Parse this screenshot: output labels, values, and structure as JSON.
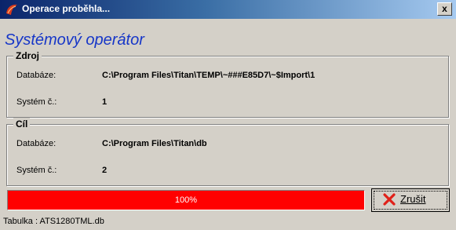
{
  "window": {
    "title": "Operace proběhla...",
    "close_label": "x"
  },
  "operator_title": "Systémový operátor",
  "source": {
    "legend": "Zdroj",
    "database_label": "Databáze:",
    "database_value": "C:\\Program Files\\Titan\\TEMP\\~###E85D7\\~$Import\\1",
    "system_label": "Systém č.:",
    "system_value": "1"
  },
  "target": {
    "legend": "Cíl",
    "database_label": "Databáze:",
    "database_value": "C:\\Program Files\\Titan\\db",
    "system_label": "Systém č.:",
    "system_value": "2"
  },
  "progress": {
    "percent": 100,
    "label": "100%",
    "fill_color": "#ff0000"
  },
  "cancel_button": {
    "label": "Zrušit",
    "icon": "x-cancel-icon"
  },
  "status": "Tabulka : ATS1280TML.db",
  "colors": {
    "title_gradient_start": "#0a246a",
    "title_gradient_end": "#a6caf0",
    "heading": "#1636c8",
    "background": "#d4d0c8"
  }
}
